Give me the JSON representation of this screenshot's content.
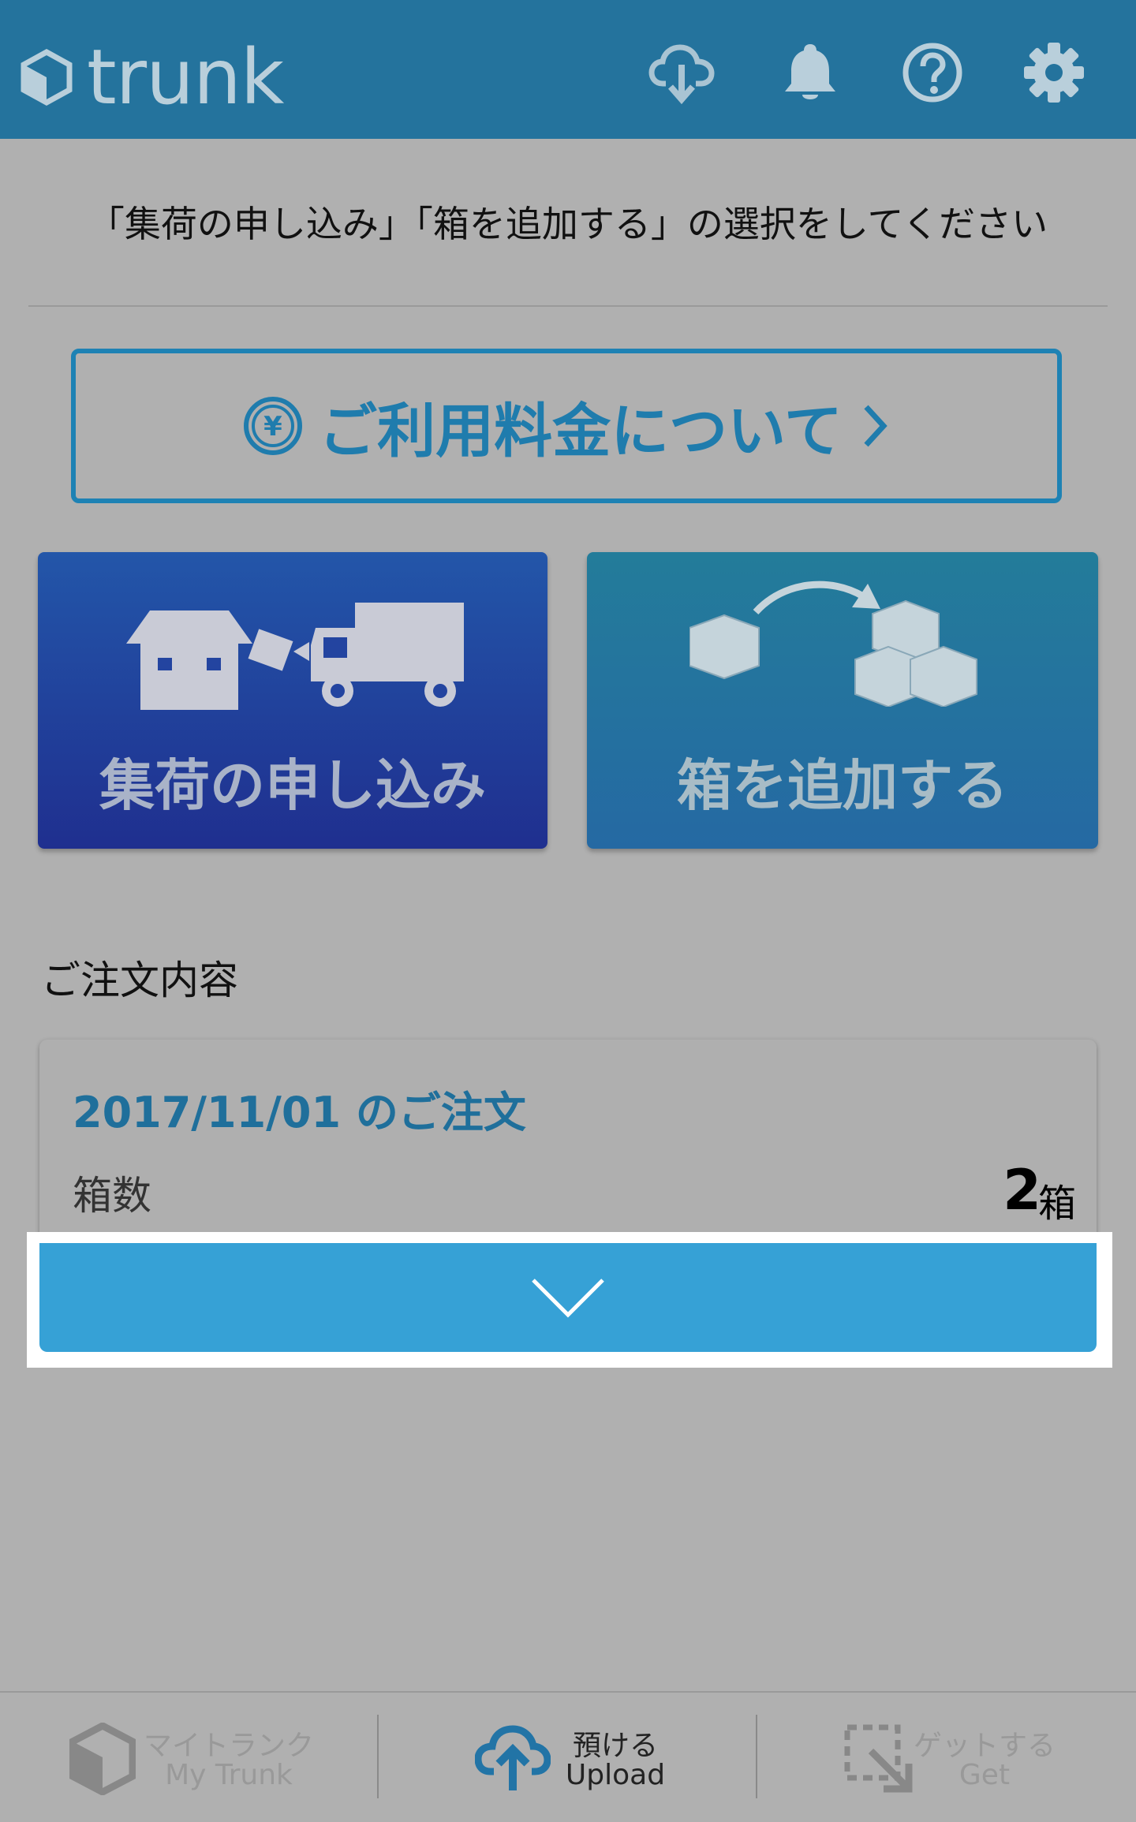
{
  "header": {
    "logo_text": "trunk",
    "icons": [
      "cloud-download-icon",
      "bell-icon",
      "help-icon",
      "gear-icon"
    ]
  },
  "instruction": "「集荷の申し込み」「箱を追加する」の選択をしてください",
  "fee_button": {
    "label": "ご利用料金について",
    "icon": "yen-icon",
    "chevron": "chevron-right-icon"
  },
  "tiles": [
    {
      "label": "集荷の申し込み",
      "icon": "house-truck-icon"
    },
    {
      "label": "箱を追加する",
      "icon": "add-boxes-icon"
    }
  ],
  "section_title": "ご注文内容",
  "order": {
    "title": "2017/11/01 のご注文",
    "count_label": "箱数",
    "count_value": "2",
    "count_unit": "箱"
  },
  "bottom_nav": [
    {
      "jp": "マイトランク",
      "en": "My Trunk",
      "icon": "cube-icon"
    },
    {
      "jp": "預ける",
      "en": "Upload",
      "icon": "cloud-upload-icon"
    },
    {
      "jp": "ゲットする",
      "en": "Get",
      "icon": "get-icon"
    }
  ],
  "colors": {
    "header": "#24739d",
    "accent": "#36a1d6",
    "tile_left": "#2345a0",
    "tile_right": "#2574a0",
    "background": "#b0b0b0"
  }
}
